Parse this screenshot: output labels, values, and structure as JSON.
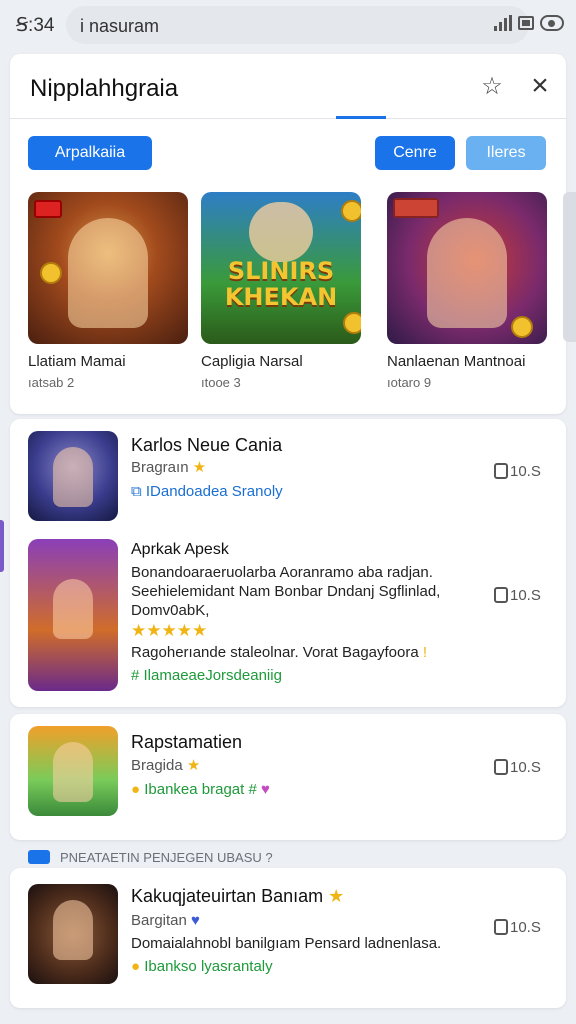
{
  "status": {
    "time": "Ꞩ:34",
    "url_text": "i nasuram"
  },
  "header": {
    "title": "Nipplahhgraia",
    "buttons": [
      "Arpalkaiia",
      "Cenre",
      "Ileres"
    ]
  },
  "featured": [
    {
      "name": "Llatiam Mamai",
      "meta": "ıatsab 2"
    },
    {
      "name": "Capligia Narsal",
      "meta": "ıtooe 3",
      "logo": "SLINIRS KHEKAN"
    },
    {
      "name": "Nanlaenan Mantnoai",
      "meta": "ıotaro 9"
    }
  ],
  "list": [
    {
      "name": "Karlos Neue Cania",
      "sub": "Bragraın",
      "tag": "IDandoadea Sranoly",
      "size": "10.S"
    },
    {
      "name": "Aprkak Apesk",
      "desc": "Bonandoaraeruolarba Aoranramo aba radjan. Seehielemidant Nam Bonbar Dndanj Sgflinlad, Domv0abK,",
      "stars": "★★★★★",
      "note": "Ragoherıande staleolnar. Vorat Bagayfoora",
      "tag": "# IlamaeaeJorsdeaniig",
      "size": "10.S"
    },
    {
      "name": "Rapstamatien",
      "sub": "Bragida",
      "tag": "Ibankea bragat #",
      "size": "10.S"
    },
    {
      "name": "Kakuqjateuirtan Banıam",
      "sub": "Bargitan",
      "desc": "Domaialahnobl banilgıam Pensard ladnenlasa.",
      "tag": "Ibankso lyasrantaly",
      "size": "10.S"
    }
  ],
  "section_label": "PNEATAETIN PENJEGEN UBASU ?"
}
